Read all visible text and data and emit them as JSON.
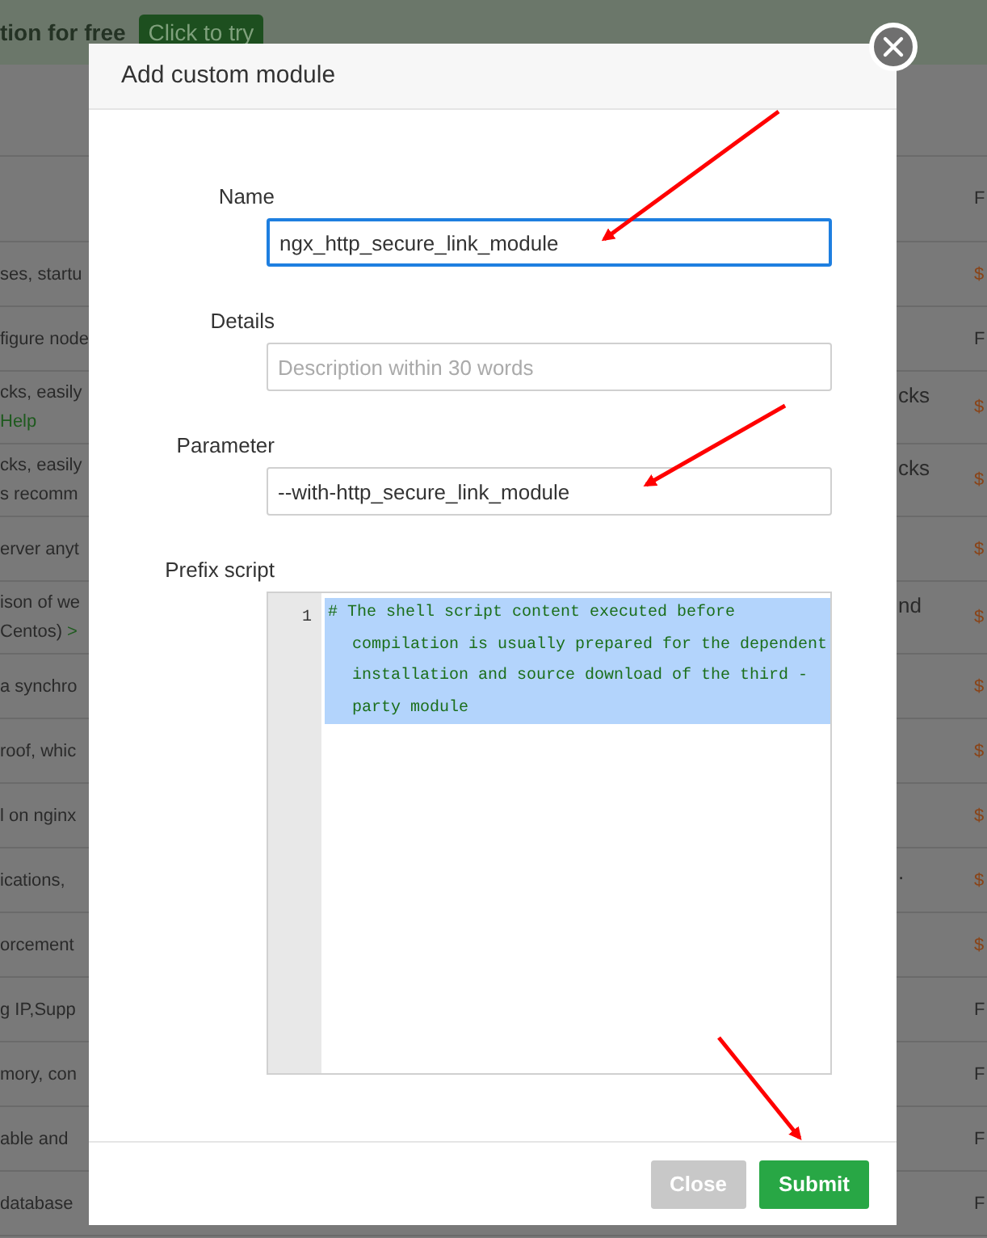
{
  "background": {
    "banner": {
      "text": "tion for free",
      "button": "Click to try"
    },
    "header": {
      "column_4": "F"
    },
    "rows": [
      {
        "column_1": [
          [
            {
              "text": "ses, startu"
            }
          ]
        ],
        "column_4": {
          "text": "$",
          "kind": "price"
        }
      },
      {
        "column_1": [
          [
            {
              "text": "figure node"
            }
          ]
        ],
        "column_4": {
          "text": "F",
          "kind": "plain"
        }
      },
      {
        "column_1": [
          [
            {
              "text": "cks, easily"
            }
          ],
          [
            {
              "text": "Help",
              "kind": "link"
            }
          ]
        ],
        "column_3": "cks",
        "column_4": {
          "text": "$",
          "kind": "price"
        }
      },
      {
        "column_1": [
          [
            {
              "text": "cks, easily"
            }
          ],
          [
            {
              "text": "s recomm"
            }
          ]
        ],
        "column_3": "cks",
        "column_4": {
          "text": "$",
          "kind": "price"
        }
      },
      {
        "column_1": [
          [
            {
              "text": "erver anyt"
            }
          ]
        ],
        "column_4": {
          "text": "$",
          "kind": "price"
        }
      },
      {
        "column_1": [
          [
            {
              "text": "ison of we"
            }
          ],
          [
            {
              "text": "Centos)"
            },
            {
              "text": ">",
              "kind": "link"
            }
          ]
        ],
        "column_3": "nd",
        "column_4": {
          "text": "$",
          "kind": "price"
        }
      },
      {
        "column_1": [
          [
            {
              "text": "a synchro"
            }
          ]
        ],
        "column_4": {
          "text": "$",
          "kind": "price"
        }
      },
      {
        "column_1": [
          [
            {
              "text": "roof, whic"
            }
          ]
        ],
        "column_4": {
          "text": "$",
          "kind": "price"
        }
      },
      {
        "column_1": [
          [
            {
              "text": "l on nginx"
            }
          ]
        ],
        "column_4": {
          "text": "$",
          "kind": "price"
        }
      },
      {
        "column_1": [
          [
            {
              "text": "ications,"
            }
          ]
        ],
        "column_3": ".",
        "column_4": {
          "text": "$",
          "kind": "price"
        }
      },
      {
        "column_1": [
          [
            {
              "text": "orcement"
            }
          ]
        ],
        "column_4": {
          "text": "$",
          "kind": "price"
        }
      },
      {
        "column_1": [
          [
            {
              "text": "g IP,Supp"
            }
          ]
        ],
        "column_4": {
          "text": "F",
          "kind": "plain"
        }
      },
      {
        "column_1": [
          [
            {
              "text": "mory, con"
            }
          ]
        ],
        "column_4": {
          "text": "F",
          "kind": "plain"
        }
      },
      {
        "column_1": [
          [
            {
              "text": "able and"
            }
          ]
        ],
        "column_4": {
          "text": "F",
          "kind": "plain"
        }
      },
      {
        "column_1": [
          [
            {
              "text": "database"
            }
          ]
        ],
        "column_4": {
          "text": "F",
          "kind": "plain"
        }
      }
    ]
  },
  "dialog": {
    "title": "Add custom module",
    "fields": [
      {
        "label": "Name",
        "value": "ngx_http_secure_link_module",
        "focused": true
      },
      {
        "label": "Details",
        "placeholder": "Description within 30 words",
        "focused": false
      },
      {
        "label": "Parameter",
        "value": "--with-http_secure_link_module",
        "focused": false
      }
    ],
    "script": {
      "label": "Prefix script",
      "line_number": "1",
      "code": "# The shell script content executed before compilation is usually prepared for the dependent installation and source download of the third -party module",
      "selected": true
    },
    "buttons": [
      {
        "label": "Close",
        "kind": "secondary"
      },
      {
        "label": "Submit",
        "kind": "primary"
      }
    ]
  }
}
